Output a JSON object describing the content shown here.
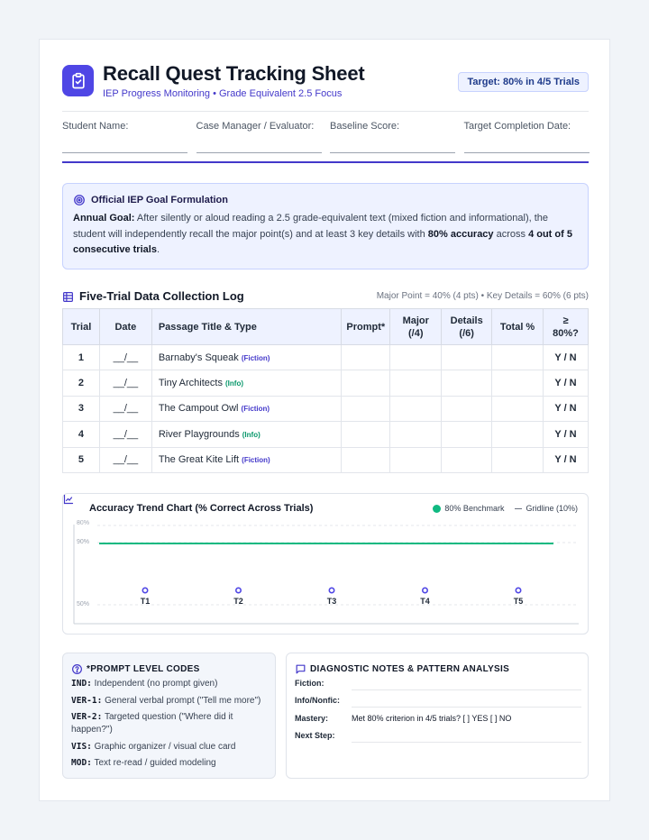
{
  "header": {
    "title": "Recall Quest Tracking Sheet",
    "subtitle": "IEP Progress Monitoring • Grade Equivalent 2.5 Focus",
    "target_badge": "Target: 80% in 4/5 Trials",
    "logo_icon": "clipboard-check-icon",
    "accent": "#4f46e5"
  },
  "fields": [
    {
      "label": "Student Name:"
    },
    {
      "label": "Case Manager / Evaluator:"
    },
    {
      "label": "Baseline Score:"
    },
    {
      "label": "Target Completion Date:"
    }
  ],
  "goal": {
    "title": "Official IEP Goal Formulation",
    "icon": "target-icon",
    "lead": "Annual Goal:",
    "text_1": " After silently or aloud reading a 2.5 grade-equivalent text (mixed fiction and informational), the student will independently recall the major point(s) and at least 3 key details with ",
    "bold_1": "80% accuracy",
    "text_2": " across ",
    "bold_2": "4 out of 5 consecutive trials",
    "text_3": "."
  },
  "log": {
    "title": "Five-Trial Data Collection Log",
    "meta": "Major Point = 40% (4 pts) • Key Details = 60% (6 pts)",
    "icon": "table-icon",
    "columns": [
      "Trial",
      "Date",
      "Passage Title & Type",
      "Prompt*",
      "Major (/4)",
      "Details (/6)",
      "Total %",
      "≥ 80%?"
    ],
    "rows": [
      {
        "trial": "1",
        "date": "__/__",
        "title": "Barnaby's Squeak",
        "type": "(Fiction)",
        "kind": "fiction",
        "yn": "Y / N"
      },
      {
        "trial": "2",
        "date": "__/__",
        "title": "Tiny Architects",
        "type": "(Info)",
        "kind": "info",
        "yn": "Y / N"
      },
      {
        "trial": "3",
        "date": "__/__",
        "title": "The Campout Owl",
        "type": "(Fiction)",
        "kind": "fiction",
        "yn": "Y / N"
      },
      {
        "trial": "4",
        "date": "__/__",
        "title": "River Playgrounds",
        "type": "(Info)",
        "kind": "info",
        "yn": "Y / N"
      },
      {
        "trial": "5",
        "date": "__/__",
        "title": "The Great Kite Lift",
        "type": "(Fiction)",
        "kind": "fiction",
        "yn": "Y / N"
      }
    ]
  },
  "chart_data": {
    "type": "line",
    "title": "Accuracy Trend Chart (% Correct Across Trials)",
    "legend": [
      "80% Benchmark",
      "Gridline (10%)"
    ],
    "legend_position": "top-right",
    "categories": [
      "T1",
      "T2",
      "T3",
      "T4",
      "T5"
    ],
    "y_tick_labels": [
      "80%",
      "90%",
      "50%"
    ],
    "benchmark_color": "#10b981",
    "point_color": "#4f46e5",
    "grid": true
  },
  "codes": {
    "title": "*PROMPT LEVEL CODES",
    "icon": "help-circle-icon",
    "items": [
      {
        "code": "IND:",
        "desc": "Independent (no prompt given)"
      },
      {
        "code": "VER-1:",
        "desc": "General verbal prompt (\"Tell me more\")"
      },
      {
        "code": "VER-2:",
        "desc": "Targeted question (\"Where did it happen?\")"
      },
      {
        "code": "VIS:",
        "desc": "Graphic organizer / visual clue card"
      },
      {
        "code": "MOD:",
        "desc": "Text re-read / guided modeling"
      }
    ]
  },
  "notes": {
    "title": "DIAGNOSTIC NOTES & PATTERN ANALYSIS",
    "icon": "message-square-icon",
    "rows": [
      {
        "label": "Fiction:",
        "text": ""
      },
      {
        "label": "Info/Nonfic:",
        "text": ""
      },
      {
        "label": "Mastery:",
        "text": "Met 80% criterion in 4/5 trials?   [   ] YES    [   ] NO"
      },
      {
        "label": "Next Step:",
        "text": ""
      }
    ]
  }
}
